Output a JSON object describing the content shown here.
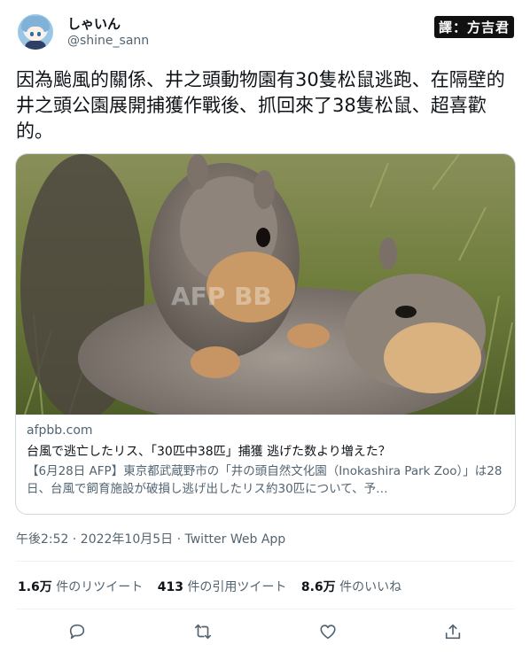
{
  "author": {
    "display_name": "しゃいん",
    "handle": "@shine_sann"
  },
  "translator_badge": "譯：方吉君",
  "tweet": {
    "text": "因為颱風的關係、井之頭動物園有30隻松鼠逃跑、在隔壁的井之頭公園展開捕獲作戰後、抓回來了38隻松鼠、超喜歡的。"
  },
  "card": {
    "image_alt": "squirrel-photo",
    "watermark": "AFP BB",
    "domain": "afpbb.com",
    "title": "台風で逃亡したリス、「30匹中38匹」捕獲 逃げた数より増えた？",
    "description": "【6月28日 AFP】東京都武蔵野市の「井の頭自然文化園（Inokashira Park Zoo）」は28日、台風で飼育施設が破損し逃げ出したリス約30匹について、予…"
  },
  "meta": {
    "timestamp": "午後2:52 · 2022年10月5日 · Twitter Web App"
  },
  "stats": {
    "retweets_count": "1.6万",
    "retweets_label": "件のリツイート",
    "quotes_count": "413",
    "quotes_label": "件の引用ツイート",
    "likes_count": "8.6万",
    "likes_label": "件のいいね"
  },
  "icons": {
    "reply": "reply-icon",
    "retweet": "retweet-icon",
    "like": "like-icon",
    "share": "share-icon"
  }
}
